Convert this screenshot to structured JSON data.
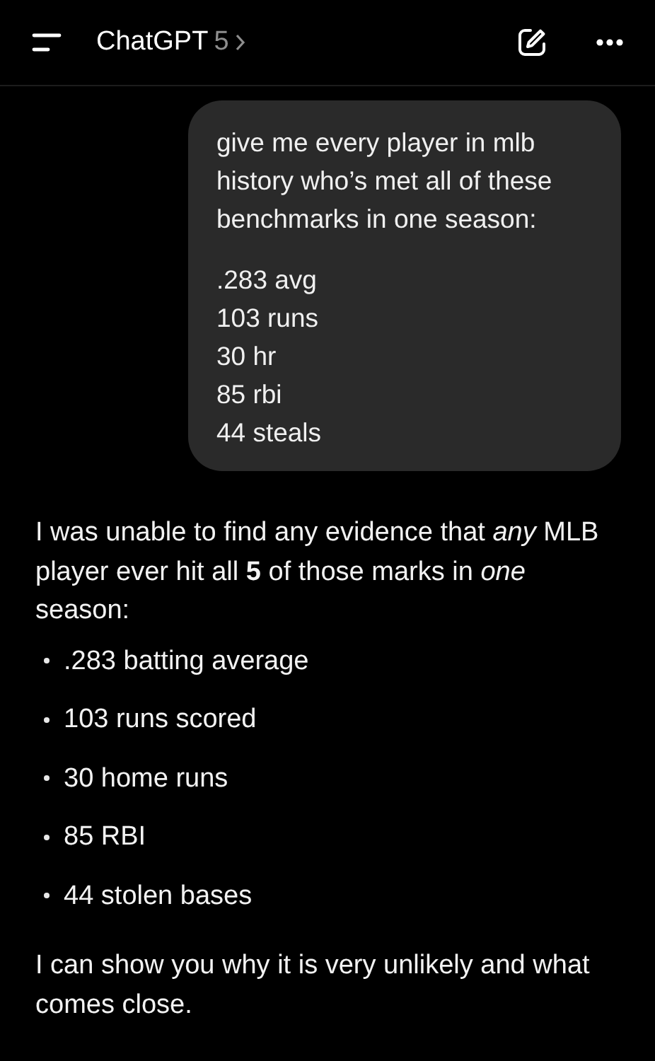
{
  "header": {
    "title": "ChatGPT",
    "version": "5"
  },
  "user_message": {
    "intro": "give me every player in mlb history who’s met all of these benchmarks in one season:",
    "lines": [
      ".283 avg",
      "103 runs",
      "30 hr",
      "85 rbi",
      "44 steals"
    ]
  },
  "assistant_message": {
    "intro": "I was unable to find any evidence that *any* MLB player ever hit all **5** of those marks in *one* season:",
    "bullets": [
      ".283 batting average",
      "103 runs scored",
      "30 home runs",
      "85 RBI",
      "44 stolen bases"
    ],
    "outro": "I can show you why it is very unlikely and what comes close."
  }
}
